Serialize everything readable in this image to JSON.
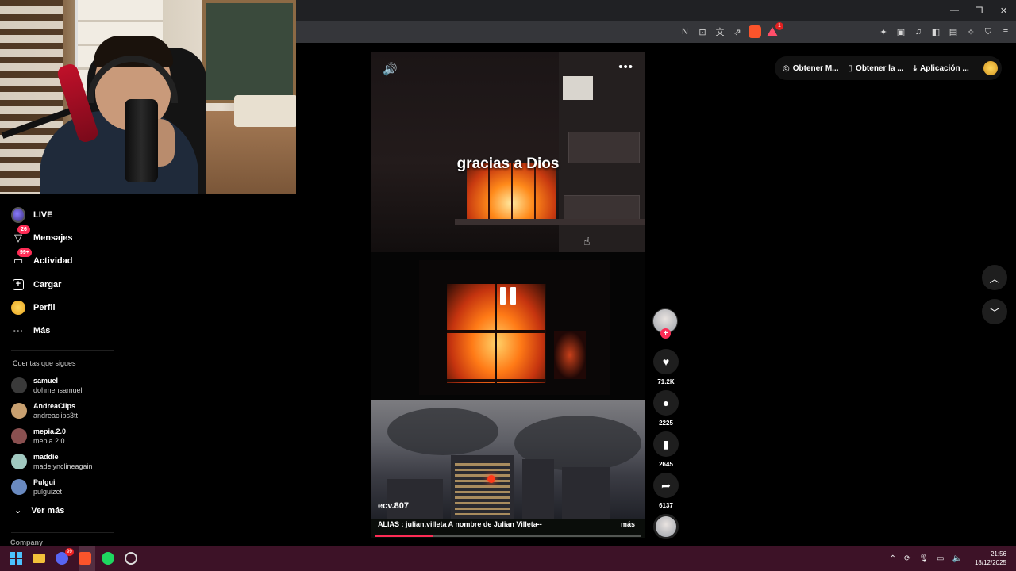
{
  "browser": {
    "window_controls": {
      "minimize": "—",
      "restore": "❐",
      "close": "✕"
    },
    "address_icons": [
      "N",
      "⊡",
      "文",
      "⇗"
    ],
    "brave_shield_count": "",
    "rewards_count": "1",
    "extension_icons": [
      "✦",
      "▣",
      "♫",
      "◧",
      "▤",
      "✧",
      "⛉",
      "≡"
    ]
  },
  "sidebar": {
    "items": [
      {
        "label": "LIVE",
        "icon": "live-icon"
      },
      {
        "label": "Mensajes",
        "icon": "messages-icon",
        "badge": "26"
      },
      {
        "label": "Actividad",
        "icon": "activity-icon",
        "badge": "99+"
      },
      {
        "label": "Cargar",
        "icon": "upload-icon"
      },
      {
        "label": "Perfil",
        "icon": "profile-icon"
      },
      {
        "label": "Más",
        "icon": "more-icon"
      }
    ],
    "following_title": "Cuentas que sigues",
    "following": [
      {
        "name": "samuel",
        "username": "dohmensamuel",
        "color": "#3a3a3a"
      },
      {
        "name": "AndreaClips",
        "username": "andreaclips3tt",
        "color": "#c8a070"
      },
      {
        "name": "mepia.2.0",
        "username": "mepia.2.0",
        "color": "#8a5050"
      },
      {
        "name": "maddie",
        "username": "madelynclineagain",
        "color": "#a0c8c0"
      },
      {
        "name": "Pulgui",
        "username": "pulguizet",
        "color": "#6a8ac0"
      }
    ],
    "see_more": "Ver más",
    "company": "Company"
  },
  "video": {
    "caption": "gracias a Dios",
    "author": "ecv.807",
    "description": "ALIAS : julian.villeta A nombre de Julian Villeta--",
    "more_label": "más",
    "progress": 0.22,
    "volume_icon": "🔊",
    "more_icon": "•••"
  },
  "actions": {
    "likes": "71.2K",
    "comments": "2225",
    "saves": "2645",
    "shares": "6137"
  },
  "top_bar": {
    "items": [
      "Obtener M...",
      "Obtener la ...",
      "Aplicación ..."
    ]
  },
  "taskbar": {
    "discord_badge": "99",
    "time": "21:56",
    "date": "18/12/2025"
  },
  "colors": {
    "accent": "#fe2c55",
    "taskbar": "#3d1227"
  }
}
